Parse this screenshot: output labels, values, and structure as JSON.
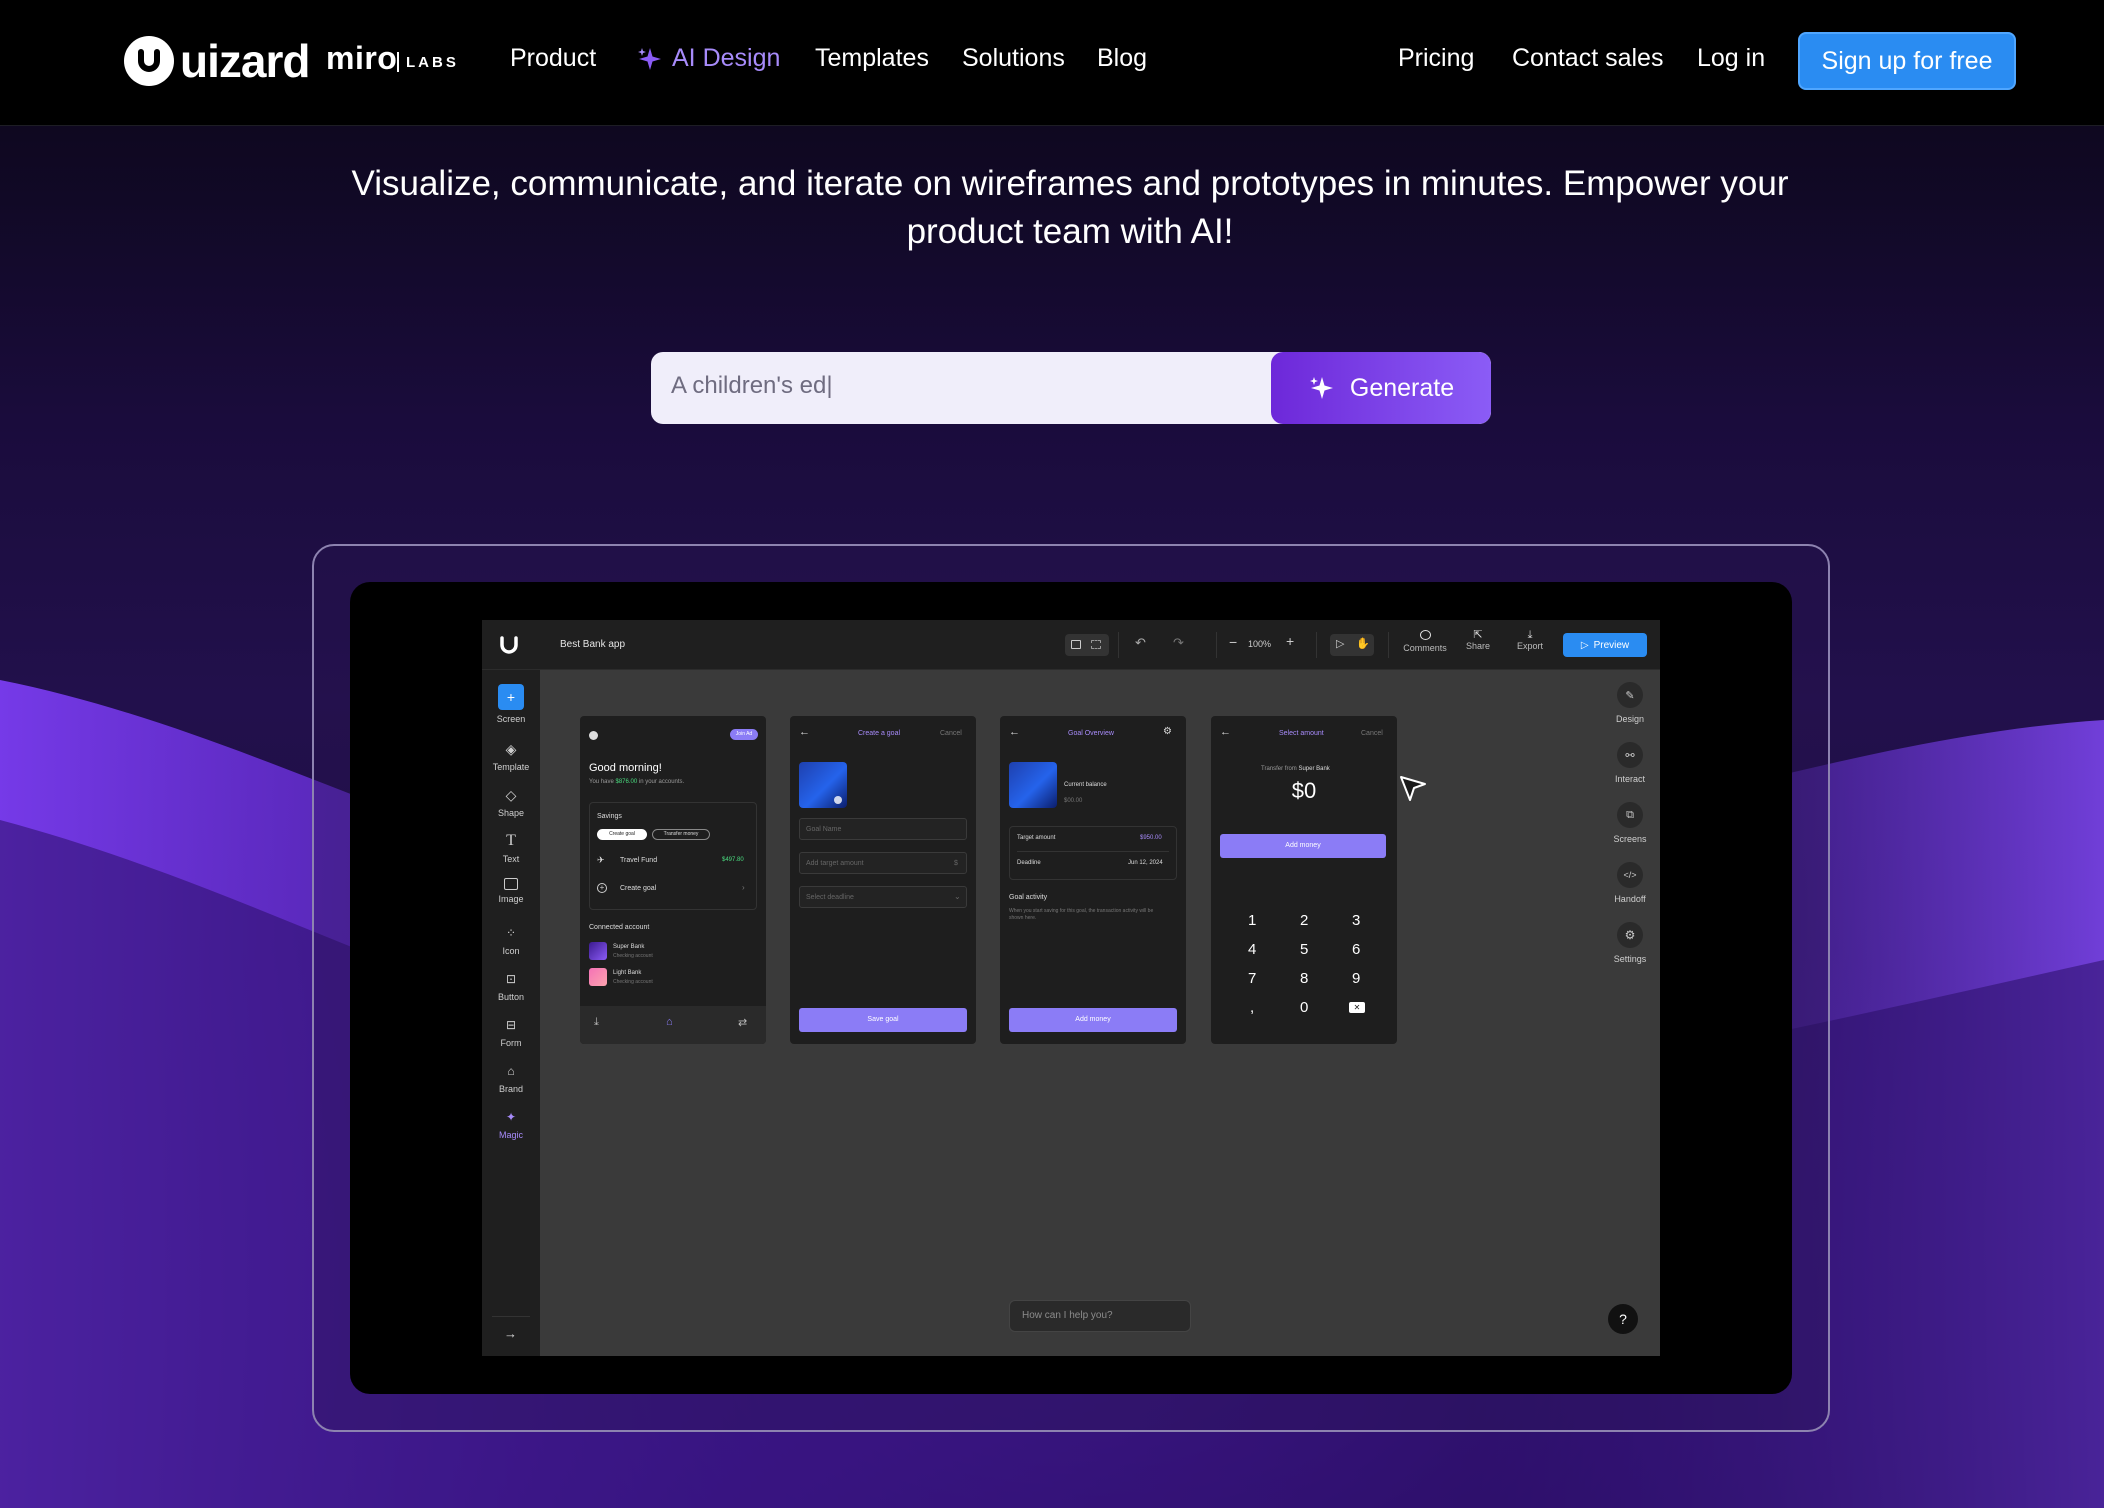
{
  "nav": {
    "logo_text": "uizard",
    "miro_text": "miro",
    "labs_text": "LABS",
    "links": [
      "Product",
      "AI Design",
      "Templates",
      "Solutions",
      "Blog"
    ],
    "right_links": [
      "Pricing",
      "Contact sales",
      "Log in"
    ],
    "signup": "Sign up for free",
    "active_color": "#a78bfa",
    "signup_color": "#2a8cf2"
  },
  "hero": {
    "line1": "Visualize, communicate, and iterate on wireframes and prototypes in minutes. Empower your",
    "line2": "product team with AI!",
    "prompt_value": "A children's ed|",
    "generate_label": "Generate"
  },
  "app": {
    "project_name": "Best Bank app",
    "zoom": "100%",
    "top_actions": [
      "Comments",
      "Share",
      "Export"
    ],
    "preview_label": "Preview",
    "left_tools": [
      "Screen",
      "Template",
      "Shape",
      "Text",
      "Image",
      "Icon",
      "Button",
      "Form",
      "Brand",
      "Magic"
    ],
    "right_tools": [
      "Design",
      "Interact",
      "Screens",
      "Handoff",
      "Settings"
    ],
    "chat_placeholder": "How can I help you?",
    "help": "?",
    "screen1": {
      "badge": "Join Ad",
      "greeting": "Good morning!",
      "subtitle_pre": "You have ",
      "subtitle_amount": "$876.00",
      "subtitle_post": " in your accounts.",
      "savings": "Savings",
      "chip1": "Create goal",
      "chip2": "Transfer money",
      "travel": "Travel Fund",
      "travel_amount": "$497.80",
      "create_goal": "Create goal",
      "connected": "Connected account",
      "acct1": "Super Bank",
      "acct1_sub": "Checking account",
      "acct2": "Light Bank",
      "acct2_sub": "Checking account"
    },
    "screen2": {
      "title": "Create a goal",
      "cancel": "Cancel",
      "field1": "Goal Name",
      "field2": "Add target amount",
      "field2_symbol": "$",
      "field3": "Select deadline",
      "button": "Save goal"
    },
    "screen3": {
      "title": "Goal Overview",
      "balance_label": "Current balance",
      "balance_value": "$00.00",
      "target_label": "Target amount",
      "target_value": "$950.00",
      "deadline_label": "Deadline",
      "deadline_value": "Jun 12, 2024",
      "activity": "Goal activity",
      "activity_note": "When you start saving for this goal, the transaction activity will be shown here.",
      "button": "Add money"
    },
    "screen4": {
      "title": "Select amount",
      "cancel": "Cancel",
      "transfer_pre": "Transfer from ",
      "transfer_bank": "Super Bank",
      "amount": "$0",
      "button": "Add money",
      "keys": [
        "1",
        "2",
        "3",
        "4",
        "5",
        "6",
        "7",
        "8",
        "9",
        ",",
        "0"
      ]
    }
  }
}
